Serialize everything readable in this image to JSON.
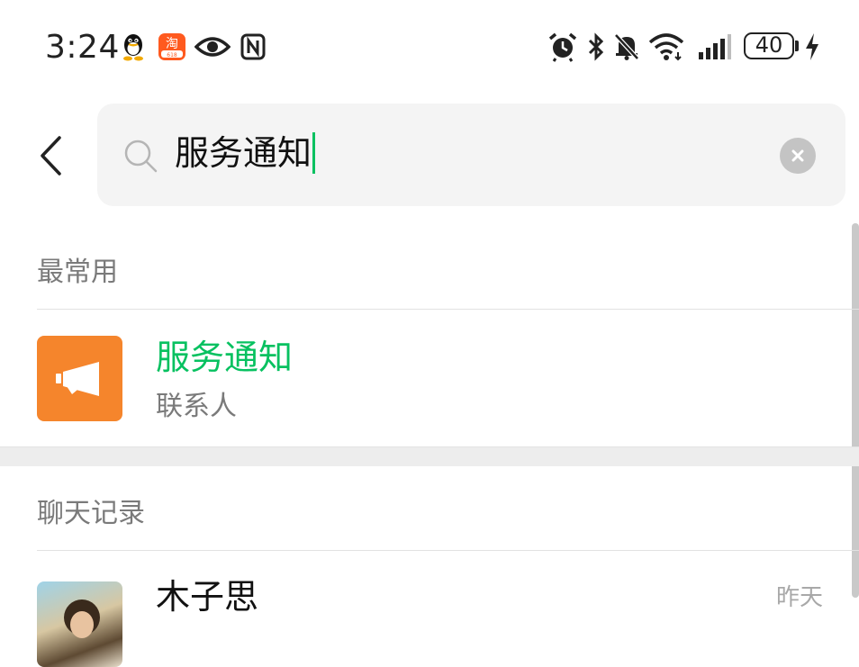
{
  "status_bar": {
    "time": "3:24",
    "battery_level": "40",
    "icons": [
      "qq-icon",
      "taobao-icon",
      "eye-icon",
      "nfc-icon",
      "alarm-icon",
      "bluetooth-icon",
      "mute-icon",
      "wifi-icon",
      "signal-icon",
      "charging-icon"
    ]
  },
  "search": {
    "query": "服务通知"
  },
  "sections": {
    "frequent": "最常用",
    "chat_history": "聊天记录"
  },
  "results": {
    "contact": {
      "title": "服务通知",
      "subtitle": "联系人",
      "icon": "megaphone-icon",
      "avatar_color": "#f5852c",
      "title_color": "#07c160"
    }
  },
  "chat_results": [
    {
      "name": "木子思",
      "time": "昨天"
    }
  ]
}
